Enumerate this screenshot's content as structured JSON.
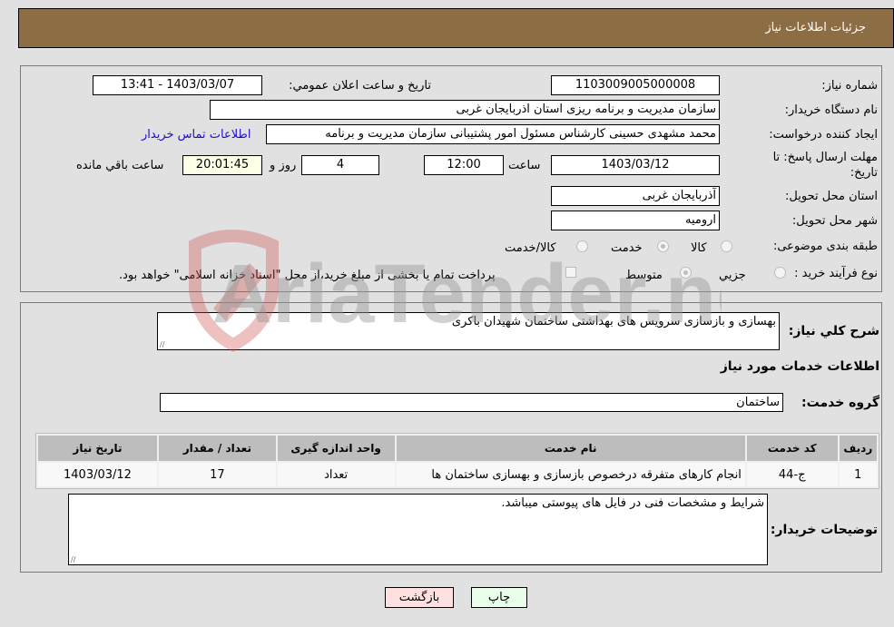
{
  "header": {
    "title": "جزئیات اطلاعات نیاز"
  },
  "details": {
    "need_number_label": "شماره نیاز:",
    "need_number": "1103009005000008",
    "announce_label": "تاریخ و ساعت اعلان عمومي:",
    "announce_value": "1403/03/07 - 13:41",
    "buyer_org_label": "نام دستگاه خریدار:",
    "buyer_org": "سازمان مدیریت و برنامه ریزی استان اذربایجان غربی",
    "creator_label": "ایجاد کننده درخواست:",
    "creator": "محمد مشهدی حسینی کارشناس مسئول امور پشتیبانی سازمان مدیریت و برنامه",
    "contact_link": "اطلاعات تماس خریدار",
    "deadline_label": "مهلت ارسال پاسخ: تا تاریخ:",
    "deadline_date": "1403/03/12",
    "time_label": "ساعت",
    "deadline_time": "12:00",
    "days_value": "4",
    "days_label": "روز و",
    "remaining_time": "20:01:45",
    "remaining_label": "ساعت باقي مانده",
    "province_label": "استان محل تحویل:",
    "province": "آذربایجان غربی",
    "city_label": "شهر محل تحویل:",
    "city": "ارومیه",
    "category_label": "طبقه بندی موضوعی:",
    "category_options": [
      {
        "label": "کالا",
        "checked": false
      },
      {
        "label": "خدمت",
        "checked": true
      },
      {
        "label": "کالا/خدمت",
        "checked": false
      }
    ],
    "process_label": "نوع فرآیند خرید :",
    "process_options": [
      {
        "label": "جزيي",
        "checked": false
      },
      {
        "label": "متوسط",
        "checked": true
      }
    ],
    "treasury_note": "پرداخت تمام یا بخشی از مبلغ خرید،از محل \"اسناد خزانه اسلامی\" خواهد بود.",
    "treasury_checked": false
  },
  "services": {
    "summary_label": "شرح كلي نياز:",
    "summary": "بهسازی و بازسازی سرویس های بهداشتی ساختمان شهیدان باکری",
    "section_title": "اطلاعات خدمات مورد نیاز",
    "group_label": "گروه خدمت:",
    "group": "ساختمان",
    "table": {
      "headers": [
        "ردیف",
        "کد خدمت",
        "نام خدمت",
        "واحد اندازه گیری",
        "تعداد / مقدار",
        "تاریخ نیاز"
      ],
      "rows": [
        [
          "1",
          "ج-44",
          "انجام کارهای متفرقه درخصوص بازسازی و بهسازی ساختمان ها",
          "تعداد",
          "17",
          "1403/03/12"
        ]
      ]
    },
    "buyer_notes_label": "توضیحات خریدار:",
    "buyer_notes": "شرایط و مشخصات فنی در فایل های پیوستی میباشد."
  },
  "buttons": {
    "print": "چاپ",
    "back": "بازگشت"
  },
  "watermark": "AriaTender.neT",
  "colors": {
    "header_bg": "#8c6d44",
    "print_btn_bg": "#eaffea",
    "back_btn_bg": "#ffe0e0",
    "link": "#1a0dcc"
  }
}
